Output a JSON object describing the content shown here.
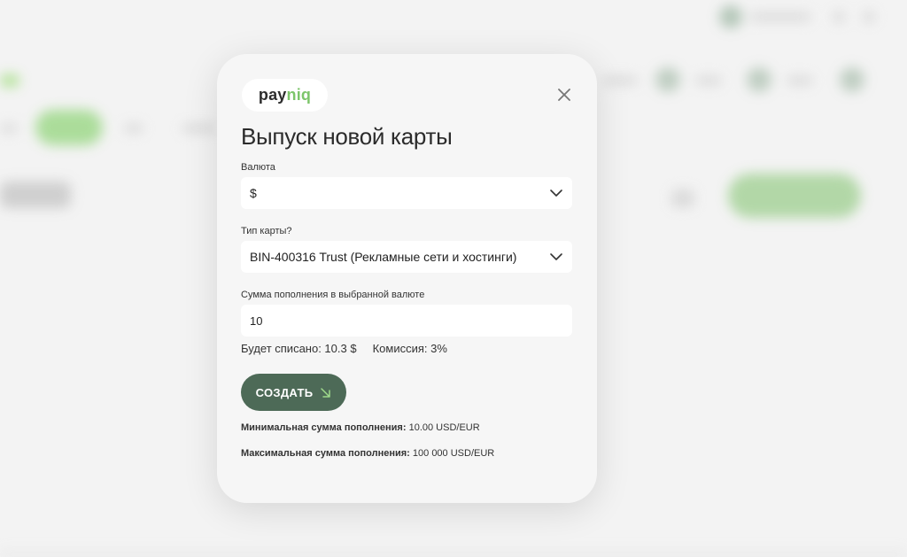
{
  "brand": {
    "logo_part1": "pay",
    "logo_part2": "niq",
    "accent": "#7cc56a",
    "primary": "#4d6a57"
  },
  "modal": {
    "title": "Выпуск новой карты",
    "currency": {
      "label": "Валюта",
      "value": "$"
    },
    "card_type": {
      "label": "Тип карты?",
      "value": "BIN-400316 Trust (Рекламные сети и хостинги)"
    },
    "amount": {
      "label": "Сумма пополнения в выбранной валюте",
      "value": "10"
    },
    "charged": "Будет списано: 10.3 $",
    "commission": "Комиссия: 3%",
    "create_label": "СОЗДАТЬ",
    "min_label": "Минимальная сумма пополнения:",
    "min_value": "10.00 USD/EUR",
    "max_label": "Максимальная сумма пополнения:",
    "max_value": "100 000 USD/EUR"
  },
  "icons": {
    "close": "close-icon",
    "chevron": "chevron-down-icon",
    "arrow": "arrow-down-right-icon"
  }
}
